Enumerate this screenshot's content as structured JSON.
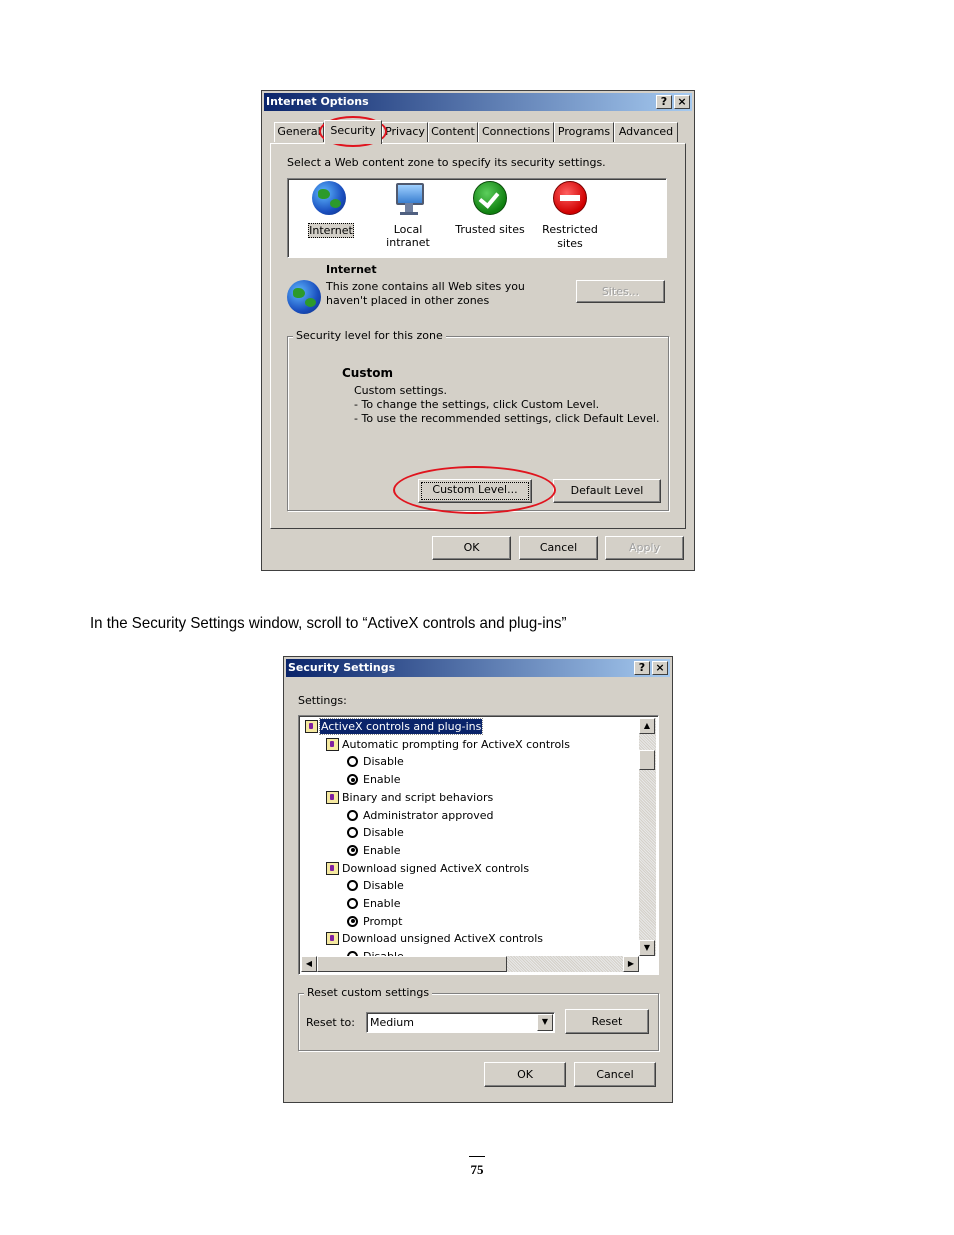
{
  "internet_options": {
    "title": "Internet Options",
    "help_btn": "?",
    "close_btn": "×",
    "tabs": [
      "General",
      "Security",
      "Privacy",
      "Content",
      "Connections",
      "Programs",
      "Advanced"
    ],
    "instruction": "Select a Web content zone to specify its security settings.",
    "zones": [
      {
        "label": "Internet",
        "icon": "globe-icon"
      },
      {
        "label": "Local intranet",
        "icon": "network-monitor-icon"
      },
      {
        "label": "Trusted sites",
        "icon": "check-icon"
      },
      {
        "label": "Restricted sites",
        "label_line1": "Restricted",
        "label_line2": "sites",
        "icon": "no-entry-icon"
      }
    ],
    "zone_title": "Internet",
    "zone_desc_line1": "This zone contains all Web sites you",
    "zone_desc_line2": "haven't placed in other zones",
    "sites_btn": "Sites...",
    "security_level_legend": "Security level for this zone",
    "level_name": "Custom",
    "level_desc1": "Custom settings.",
    "level_desc2": "- To change the settings, click Custom Level.",
    "level_desc3": "- To use the recommended settings, click Default Level.",
    "custom_level_btn": "Custom Level...",
    "default_level_btn": "Default Level",
    "ok_btn": "OK",
    "cancel_btn": "Cancel",
    "apply_btn": "Apply",
    "highlight_color": "#e0141e"
  },
  "instruction_text": "In the Security Settings window, scroll to “ActiveX controls and plug-ins”",
  "security_settings": {
    "title": "Security Settings",
    "help_btn": "?",
    "close_btn": "×",
    "settings_label": "Settings:",
    "tree": [
      {
        "type": "category",
        "label": "ActiveX controls and plug-ins",
        "level": 0,
        "selected": true
      },
      {
        "type": "setting",
        "label": "Automatic prompting for ActiveX controls",
        "level": 1
      },
      {
        "type": "option",
        "label": "Disable",
        "level": 2,
        "checked": false
      },
      {
        "type": "option",
        "label": "Enable",
        "level": 2,
        "checked": true
      },
      {
        "type": "setting",
        "label": "Binary and script behaviors",
        "level": 1
      },
      {
        "type": "option",
        "label": "Administrator approved",
        "level": 2,
        "checked": false
      },
      {
        "type": "option",
        "label": "Disable",
        "level": 2,
        "checked": false
      },
      {
        "type": "option",
        "label": "Enable",
        "level": 2,
        "checked": true
      },
      {
        "type": "setting",
        "label": "Download signed ActiveX controls",
        "level": 1
      },
      {
        "type": "option",
        "label": "Disable",
        "level": 2,
        "checked": false
      },
      {
        "type": "option",
        "label": "Enable",
        "level": 2,
        "checked": false
      },
      {
        "type": "option",
        "label": "Prompt",
        "level": 2,
        "checked": true
      },
      {
        "type": "setting",
        "label": "Download unsigned ActiveX controls",
        "level": 1
      },
      {
        "type": "option",
        "label": "Disable",
        "level": 2,
        "checked": false
      }
    ],
    "reset_legend": "Reset custom settings",
    "reset_to_label": "Reset to:",
    "reset_to_value": "Medium",
    "reset_btn": "Reset",
    "ok_btn": "OK",
    "cancel_btn": "Cancel"
  },
  "page_number": "75"
}
